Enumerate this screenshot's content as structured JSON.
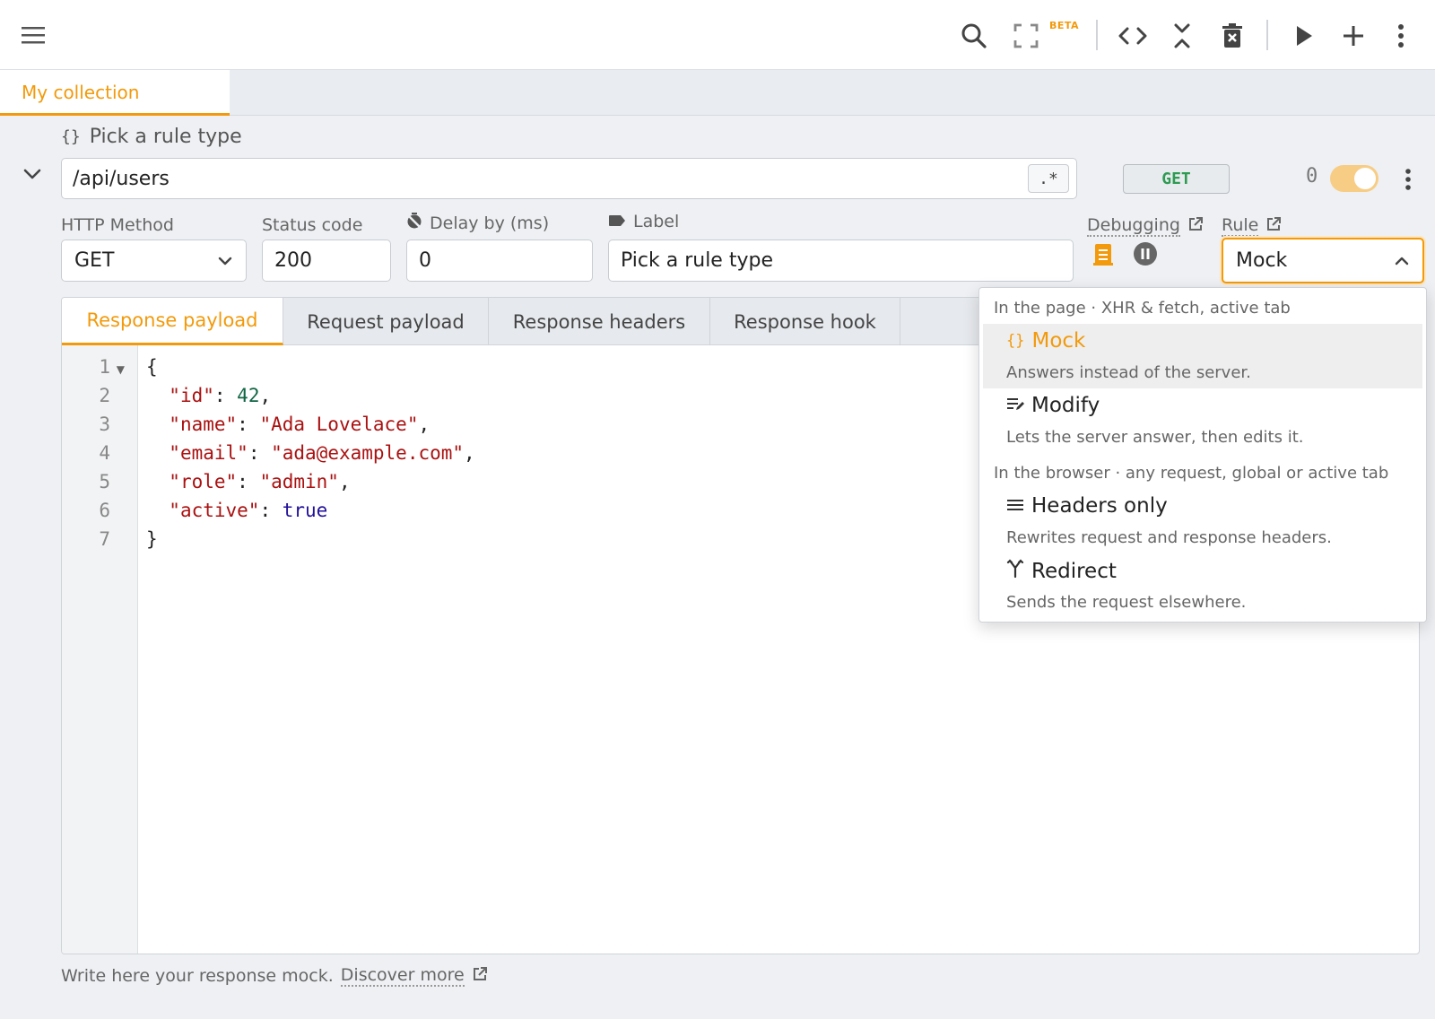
{
  "toolbar": {
    "beta_label": "BETA"
  },
  "collection_tab": {
    "label": "My collection"
  },
  "rule": {
    "rule_type_caption": "Pick a rule type",
    "url": "/api/users",
    "regex_label": ".*",
    "method_badge": "GET",
    "hit_count": "0",
    "enabled": true
  },
  "fields": {
    "http_method_label": "HTTP Method",
    "http_method_value": "GET",
    "status_code_label": "Status code",
    "status_code_value": "200",
    "delay_label": "Delay by (ms)",
    "delay_value": "0",
    "label_label": "Label",
    "label_value": "Pick a rule type",
    "debugging_label": "Debugging",
    "rule_label": "Rule",
    "rule_value": "Mock"
  },
  "editor": {
    "tabs": [
      {
        "label": "Response payload",
        "active": true
      },
      {
        "label": "Request payload",
        "active": false
      },
      {
        "label": "Response headers",
        "active": false
      },
      {
        "label": "Response hook",
        "active": false
      }
    ],
    "line_numbers": [
      "1",
      "2",
      "3",
      "4",
      "5",
      "6",
      "7"
    ],
    "lines": {
      "l1": "{",
      "l2_key": "\"id\"",
      "l2_val": "42",
      "l3_key": "\"name\"",
      "l3_val": "\"Ada Lovelace\"",
      "l4_key": "\"email\"",
      "l4_val": "\"ada@example.com\"",
      "l5_key": "\"role\"",
      "l5_val": "\"admin\"",
      "l6_key": "\"active\"",
      "l6_val": "true",
      "l7": "}"
    }
  },
  "hint": {
    "text": "Write here your response mock.",
    "link": "Discover more"
  },
  "dropdown": {
    "group1": "In the page · XHR & fetch, active tab",
    "group2": "In the browser · any request, global or active tab",
    "items": [
      {
        "title": "Mock",
        "desc": "Answers instead of the server.",
        "icon": "braces-icon",
        "selected": true
      },
      {
        "title": "Modify",
        "desc": "Lets the server answer, then edits it.",
        "icon": "edit-lines-icon",
        "selected": false
      },
      {
        "title": "Headers only",
        "desc": "Rewrites request and response headers.",
        "icon": "lines-icon",
        "selected": false
      },
      {
        "title": "Redirect",
        "desc": "Sends the request elsewhere.",
        "icon": "fork-icon",
        "selected": false
      }
    ]
  },
  "colors": {
    "accent": "#f29a0b",
    "method_green": "#2e9b52"
  }
}
